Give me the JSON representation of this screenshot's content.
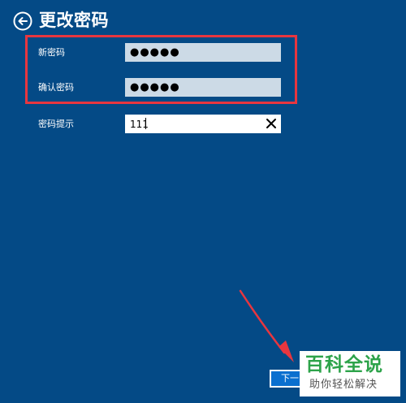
{
  "header": {
    "title": "更改密码",
    "back_icon": "back-arrow-circle-icon"
  },
  "form": {
    "new_password": {
      "label": "新密码",
      "value": "●●●●●"
    },
    "confirm_password": {
      "label": "确认密码",
      "value": "●●●●●"
    },
    "password_hint": {
      "label": "密码提示",
      "value": "111",
      "clear_icon": "close-icon"
    }
  },
  "footer": {
    "next_label": "下一"
  },
  "watermark": {
    "title": "百科全说",
    "subtitle": "助你轻松解决"
  },
  "colors": {
    "background": "#044a86",
    "highlight_border": "#e8363f",
    "arrow": "#e8363f",
    "password_field_bg": "#ccdae6",
    "next_button_bg": "#0a6fcf",
    "watermark_green": "#2da34a"
  }
}
